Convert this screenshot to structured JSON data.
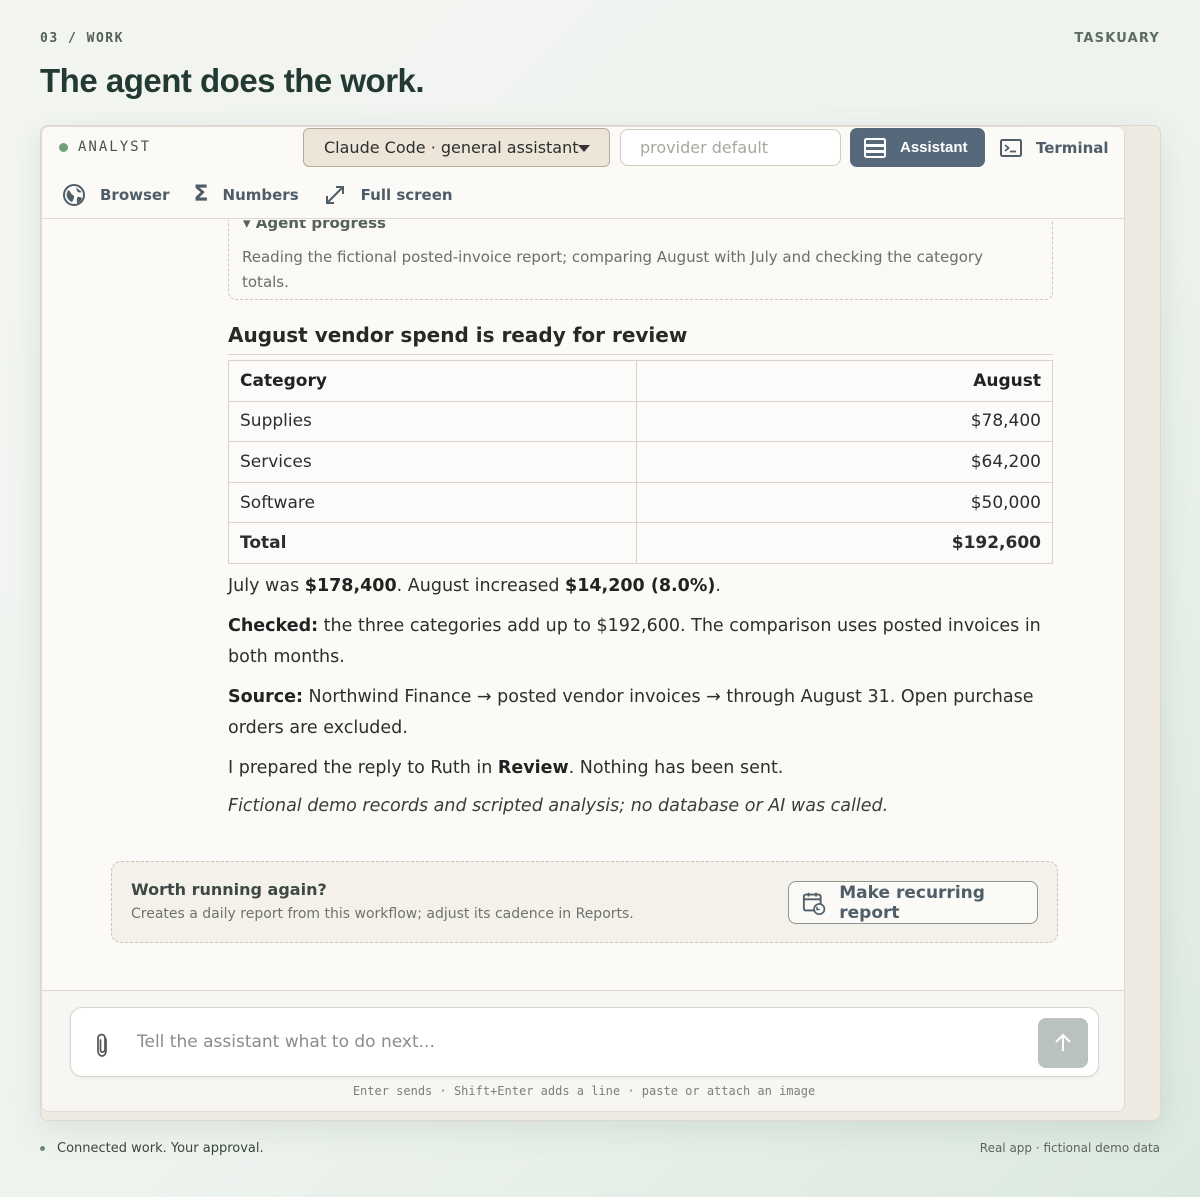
{
  "page": {
    "kicker": "03 / WORK",
    "brand": "TASKUARY",
    "headline": "The agent does the work."
  },
  "toolbar": {
    "panel_label": "ANALYST",
    "agent_select": "Claude Code · general assistant",
    "provider_placeholder": "provider default",
    "assistant_label": "Assistant",
    "terminal_label": "Terminal",
    "browser_label": "Browser",
    "numbers_label": "Numbers",
    "fullscreen_label": "Full screen"
  },
  "progress": {
    "title": "▾ Agent progress",
    "body": "Reading the fictional posted-invoice report; comparing August with July and checking the category totals."
  },
  "report": {
    "title": "August vendor spend is ready for review",
    "headers": [
      "Category",
      "August"
    ],
    "rows": [
      [
        "Supplies",
        "$78,400"
      ],
      [
        "Services",
        "$64,200"
      ],
      [
        "Software",
        "$50,000"
      ]
    ],
    "total": [
      "Total",
      "$192,600"
    ]
  },
  "paragraphs": {
    "p1_a": "July was ",
    "p1_b": "$178,400",
    "p1_c": ". August increased ",
    "p1_d": "$14,200 (8.0%)",
    "p1_e": ".",
    "p2_label": "Checked:",
    "p2_text": " the three categories add up to $192,600. The comparison uses posted invoices in both months.",
    "p3_label": "Source:",
    "p3_text": " Northwind Finance → posted vendor invoices → through August 31. Open purchase orders are excluded.",
    "p4_a": "I prepared the reply to Ruth in ",
    "p4_b": "Review",
    "p4_c": ". Nothing has been sent.",
    "disclaimer": "Fictional demo records and scripted analysis; no database or AI was called."
  },
  "recurring": {
    "title": "Worth running again?",
    "subtitle": "Creates a daily report from this workflow; adjust its cadence in Reports.",
    "button": "Make recurring report"
  },
  "composer": {
    "placeholder": "Tell the assistant what to do next...",
    "hint": "Enter sends · Shift+Enter adds a line · paste or attach an image"
  },
  "footer": {
    "left": "Connected work. Your approval.",
    "right": "Real app · fictional demo data"
  },
  "colors": {
    "accent": "#56697a",
    "headline": "#223a32",
    "status_dot": "#6fa07a"
  }
}
